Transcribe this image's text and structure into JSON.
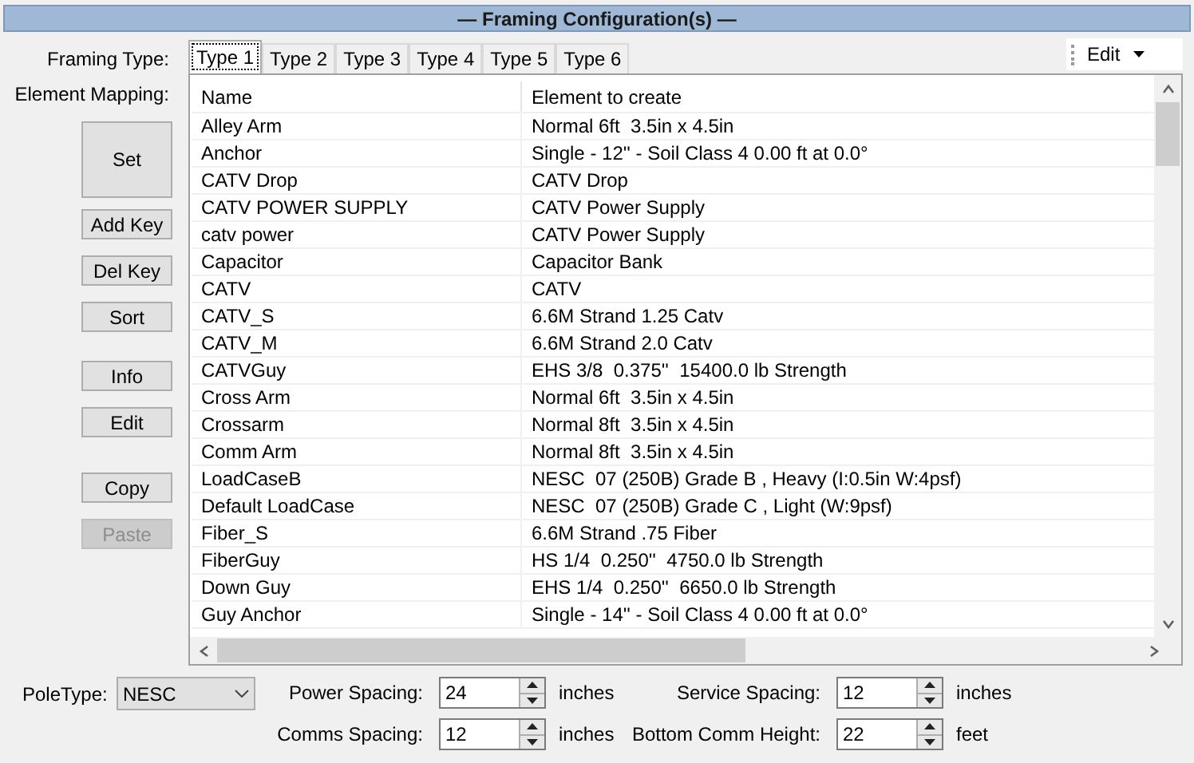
{
  "title": "— Framing Configuration(s) —",
  "framing_type_label": "Framing Type:",
  "tabs": [
    {
      "label": "Type 1",
      "selected": true
    },
    {
      "label": "Type 2",
      "selected": false
    },
    {
      "label": "Type 3",
      "selected": false
    },
    {
      "label": "Type 4",
      "selected": false
    },
    {
      "label": "Type 5",
      "selected": false
    },
    {
      "label": "Type 6",
      "selected": false
    }
  ],
  "edit_menu": {
    "label": "Edit"
  },
  "element_mapping_label": "Element Mapping:",
  "button_groups": [
    [
      {
        "label": "Set",
        "kind": "large",
        "disabled": false
      }
    ],
    [
      {
        "label": "Add Key",
        "kind": "small",
        "disabled": false
      },
      {
        "label": "Del Key",
        "kind": "small",
        "disabled": false
      },
      {
        "label": "Sort",
        "kind": "small",
        "disabled": false
      }
    ],
    [
      {
        "label": "Info",
        "kind": "small",
        "disabled": false
      },
      {
        "label": "Edit",
        "kind": "small",
        "disabled": false
      }
    ],
    [
      {
        "label": "Copy",
        "kind": "small",
        "disabled": false
      },
      {
        "label": "Paste",
        "kind": "small",
        "disabled": true
      }
    ]
  ],
  "table": {
    "columns": [
      "Name",
      "Element to create"
    ],
    "rows": [
      [
        "Alley Arm",
        "Normal 6ft  3.5in x 4.5in"
      ],
      [
        "Anchor",
        "Single - 12'' - Soil Class 4 0.00 ft at 0.0°"
      ],
      [
        "CATV Drop",
        "CATV Drop"
      ],
      [
        "CATV POWER SUPPLY",
        "CATV Power Supply"
      ],
      [
        "catv power",
        "CATV Power Supply"
      ],
      [
        "Capacitor",
        "Capacitor Bank"
      ],
      [
        "CATV",
        "CATV"
      ],
      [
        "CATV_S",
        "6.6M Strand 1.25 Catv"
      ],
      [
        "CATV_M",
        "6.6M Strand 2.0 Catv"
      ],
      [
        "CATVGuy",
        "EHS 3/8  0.375''  15400.0 lb Strength"
      ],
      [
        "Cross Arm",
        "Normal 6ft  3.5in x 4.5in"
      ],
      [
        "Crossarm",
        "Normal 8ft  3.5in x 4.5in"
      ],
      [
        "Comm Arm",
        "Normal 8ft  3.5in x 4.5in"
      ],
      [
        "LoadCaseB",
        "NESC  07 (250B) Grade B , Heavy (I:0.5in W:4psf)"
      ],
      [
        "Default LoadCase",
        "NESC  07 (250B) Grade C , Light (W:9psf)"
      ],
      [
        "Fiber_S",
        "6.6M Strand .75 Fiber"
      ],
      [
        "FiberGuy",
        "HS 1/4  0.250''  4750.0 lb Strength"
      ],
      [
        "Down Guy",
        "EHS 1/4  0.250''  6650.0 lb Strength"
      ],
      [
        "Guy Anchor",
        "Single - 14'' - Soil Class 4 0.00 ft at 0.0°"
      ]
    ]
  },
  "pole_type": {
    "label": "PoleType:",
    "value": "NESC"
  },
  "spacing_fields": [
    {
      "label": "Power Spacing:",
      "value": "24",
      "unit": "inches"
    },
    {
      "label": "Service Spacing:",
      "value": "12",
      "unit": "inches"
    },
    {
      "label": "Comms Spacing:",
      "value": "12",
      "unit": "inches"
    },
    {
      "label": "Bottom Comm Height:",
      "value": "22",
      "unit": "feet"
    }
  ]
}
